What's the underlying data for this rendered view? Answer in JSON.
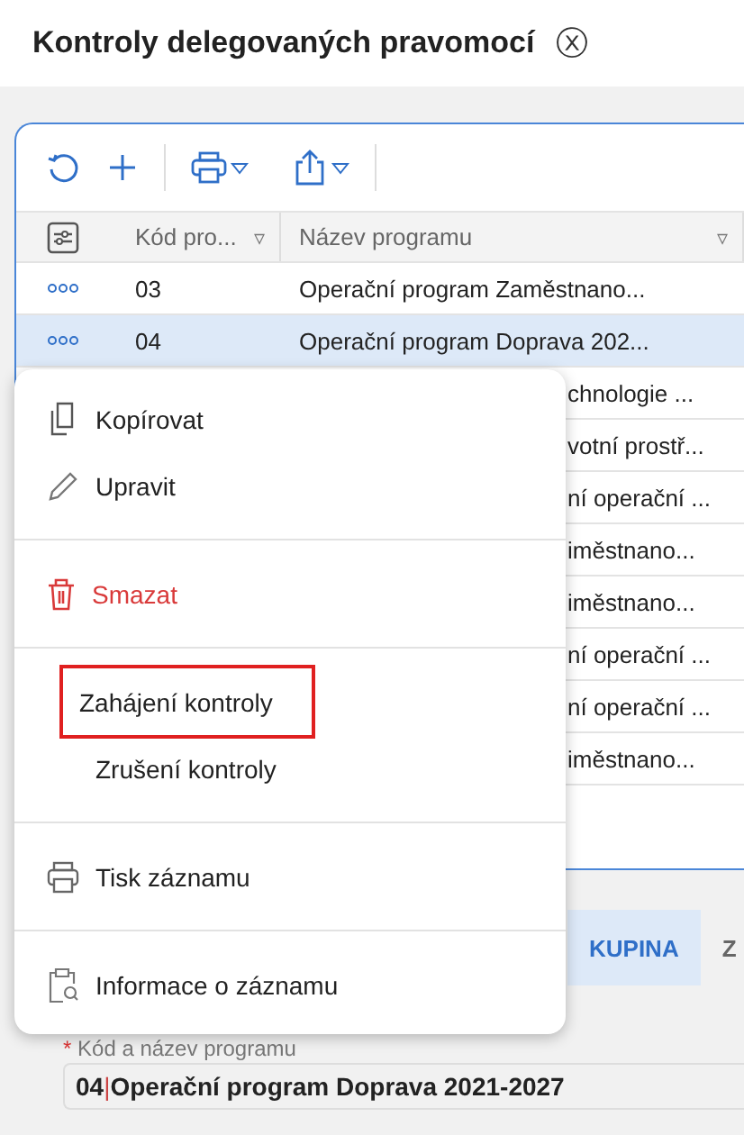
{
  "window": {
    "title": "Kontroly delegovaných pravomocí",
    "close_icon": "ⓧ"
  },
  "table": {
    "columns": [
      {
        "label": "Kód pro...",
        "sort_icon": "▿"
      },
      {
        "label": "Název programu",
        "sort_icon": "▿"
      }
    ],
    "rows": [
      {
        "kind": "full",
        "selected": false,
        "code": "03",
        "name": "Operační program Zaměstnano..."
      },
      {
        "kind": "full",
        "selected": true,
        "code": "04",
        "name": "Operační program Doprava 202..."
      },
      {
        "kind": "partial",
        "selected": false,
        "name": "chnologie ..."
      },
      {
        "kind": "partial",
        "selected": false,
        "name": "votní prostř..."
      },
      {
        "kind": "partial",
        "selected": false,
        "name": "ní operační ..."
      },
      {
        "kind": "partial",
        "selected": false,
        "name": "iměstnano..."
      },
      {
        "kind": "partial",
        "selected": false,
        "name": "iměstnano..."
      },
      {
        "kind": "partial",
        "selected": false,
        "name": "ní operační ..."
      },
      {
        "kind": "partial",
        "selected": false,
        "name": "ní operační ..."
      },
      {
        "kind": "partial",
        "selected": false,
        "name": "iměstnano..."
      }
    ]
  },
  "context_menu": {
    "groups": [
      [
        {
          "label": "Kopírovat",
          "kind": "copy",
          "danger": false,
          "highlighted": false
        },
        {
          "label": "Upravit",
          "kind": "edit",
          "danger": false,
          "highlighted": false
        }
      ],
      [
        {
          "label": "Smazat",
          "kind": "delete",
          "danger": true,
          "highlighted": false
        }
      ],
      [
        {
          "label": "Zahájení kontroly",
          "kind": "plain",
          "danger": false,
          "highlighted": true
        },
        {
          "label": "Zrušení kontroly",
          "kind": "plain",
          "danger": false,
          "highlighted": false
        }
      ],
      [
        {
          "label": "Tisk záznamu",
          "kind": "print",
          "danger": false,
          "highlighted": false
        }
      ],
      [
        {
          "label": "Informace o záznamu",
          "kind": "info",
          "danger": false,
          "highlighted": false
        }
      ]
    ]
  },
  "tabs": [
    {
      "label": "KUPINA",
      "selected": true
    },
    {
      "label": "Z",
      "selected": false
    }
  ],
  "field": {
    "label": "Kód a název programu",
    "required_mark": "*",
    "code": "04",
    "separator": "|",
    "name": "Operační program Doprava 2021-2027"
  }
}
